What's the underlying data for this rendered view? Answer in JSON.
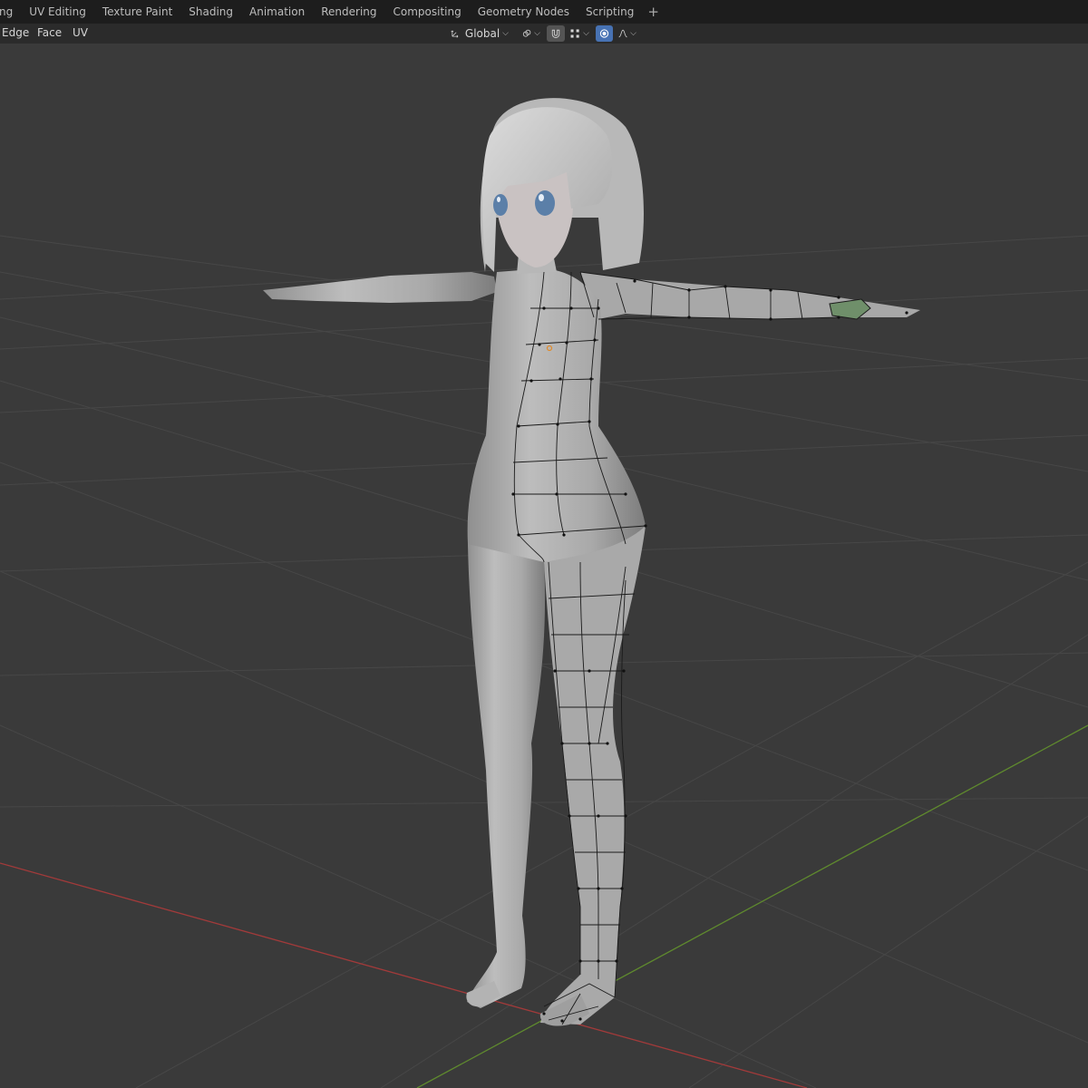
{
  "workspace_tabs": [
    {
      "label": "ng"
    },
    {
      "label": "UV Editing"
    },
    {
      "label": "Texture Paint"
    },
    {
      "label": "Shading"
    },
    {
      "label": "Animation"
    },
    {
      "label": "Rendering"
    },
    {
      "label": "Compositing"
    },
    {
      "label": "Geometry Nodes"
    },
    {
      "label": "Scripting"
    }
  ],
  "add_tab": "+",
  "header_menu": {
    "edge": "Edge",
    "face": "Face",
    "uv": "UV"
  },
  "transform": {
    "orientation": "Global"
  },
  "icons": {
    "orientation": "transform-orientation-icon",
    "pivot": "pivot-point-icon",
    "snap": "magnet-snap-icon",
    "snap_target": "snap-increment-icon",
    "proportional": "proportional-editing-icon",
    "falloff": "falloff-curve-icon"
  },
  "colors": {
    "x_axis": "#a23a3a",
    "y_axis": "#5f8a2e",
    "proportional_active": "#4772b3"
  }
}
